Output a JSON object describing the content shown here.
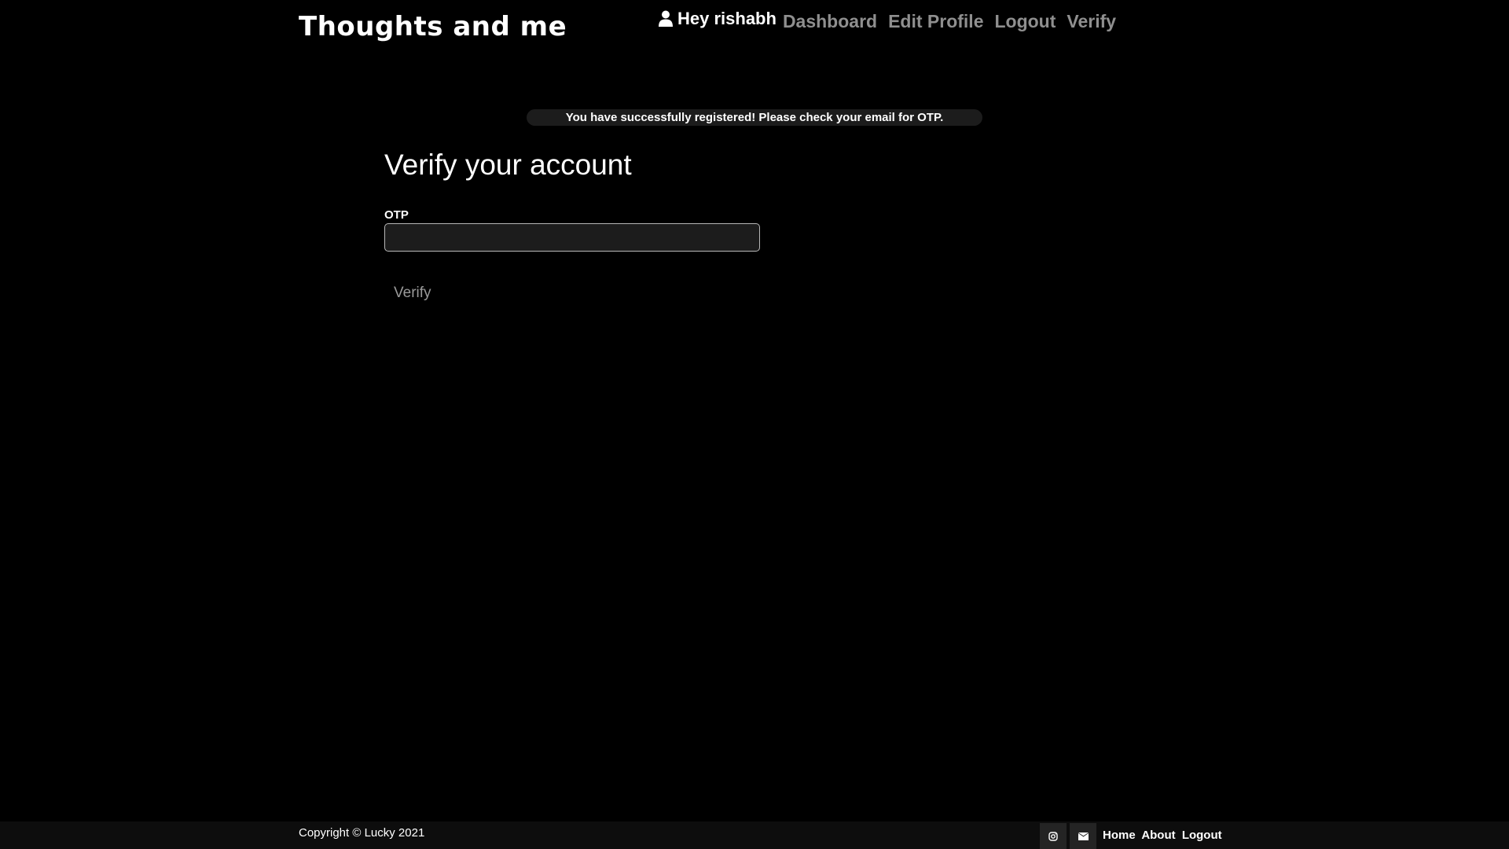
{
  "header": {
    "brand": "Thoughts and me",
    "greeting": "Hey rishabh",
    "nav": [
      {
        "label": "Dashboard"
      },
      {
        "label": "Edit Profile"
      },
      {
        "label": "Logout"
      },
      {
        "label": "Verify"
      }
    ]
  },
  "alert": {
    "message": "You have successfully registered! Please check your email for OTP."
  },
  "form": {
    "title": "Verify your account",
    "otp_label": "OTP",
    "otp_value": "",
    "submit_label": "Verify"
  },
  "footer": {
    "copyright": "Copyright © Lucky 2021",
    "social": [
      {
        "icon": "instagram-icon"
      },
      {
        "icon": "envelope-icon"
      }
    ],
    "links": [
      {
        "label": "Home"
      },
      {
        "label": "About"
      },
      {
        "label": "Logout"
      }
    ]
  },
  "colors": {
    "background": "#000000",
    "nav_link": "#8f8f8f",
    "alert_bg": "#1c1c1c",
    "input_bg": "#1c1c1c",
    "footer_bg": "#0d0d0d"
  }
}
